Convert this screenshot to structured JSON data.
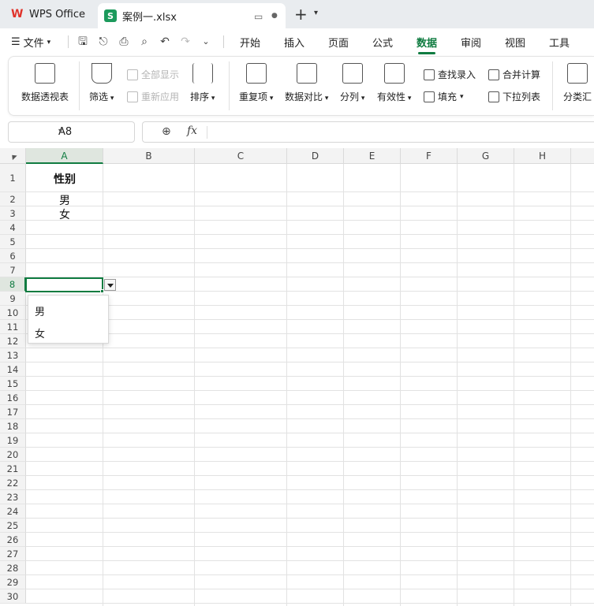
{
  "tabs": {
    "app_tab": "WPS Office",
    "file_tab": "案例一.xlsx"
  },
  "menu": {
    "file": "文件",
    "items": [
      "开始",
      "插入",
      "页面",
      "公式",
      "数据",
      "审阅",
      "视图",
      "工具"
    ],
    "active": "数据"
  },
  "ribbon": {
    "pivot": "数据透视表",
    "filter": "筛选",
    "show_all": "全部显示",
    "reapply": "重新应用",
    "sort": "排序",
    "duplicates": "重复项",
    "compare": "数据对比",
    "split": "分列",
    "validity": "有效性",
    "lookup": "查找录入",
    "fill": "填充",
    "consolidate": "合并计算",
    "dropdown_list": "下拉列表",
    "subtotal": "分类汇"
  },
  "formula_bar": {
    "name_box": "A8",
    "fx": "fx",
    "content": ""
  },
  "grid": {
    "columns": [
      "A",
      "B",
      "C",
      "D",
      "E",
      "F",
      "G",
      "H"
    ],
    "selected_column": "A",
    "rows": [
      "1",
      "2",
      "3",
      "4",
      "5",
      "6",
      "7",
      "8",
      "9",
      "10",
      "11",
      "12",
      "13",
      "14",
      "15",
      "16",
      "17",
      "18",
      "19",
      "20",
      "21",
      "22",
      "23",
      "24",
      "25",
      "26",
      "27",
      "28",
      "29",
      "30"
    ],
    "selected_row": "8",
    "cells": {
      "A1": "性别",
      "A2": "男",
      "A3": "女"
    }
  },
  "dropdown": {
    "options": [
      "男",
      "女"
    ]
  },
  "colors": {
    "accent": "#107c41",
    "wps_red": "#e0332b"
  }
}
